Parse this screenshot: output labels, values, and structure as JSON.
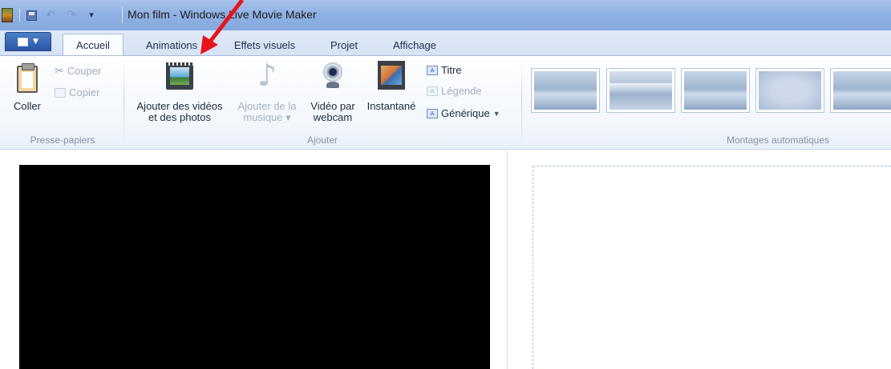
{
  "window": {
    "title": "Mon film - Windows Live Movie Maker"
  },
  "quick_access": {
    "app_icon": "movie-maker-icon",
    "save_icon": "save-icon",
    "undo_icon": "undo-icon",
    "redo_icon": "redo-icon",
    "dropdown_glyph": "▾"
  },
  "tabs": [
    {
      "label": "Accueil",
      "active": true
    },
    {
      "label": "Animations",
      "active": false
    },
    {
      "label": "Effets visuels",
      "active": false
    },
    {
      "label": "Projet",
      "active": false
    },
    {
      "label": "Affichage",
      "active": false
    }
  ],
  "ribbon": {
    "clipboard": {
      "paste_label": "Coller",
      "cut_label": "Couper",
      "copy_label": "Copier",
      "group_label": "Presse-papiers"
    },
    "add": {
      "add_videos_photos_label_1": "Ajouter des vidéos",
      "add_videos_photos_label_2": "et des photos",
      "add_music_label_1": "Ajouter de la",
      "add_music_label_2": "musique",
      "webcam_label_1": "Vidéo par",
      "webcam_label_2": "webcam",
      "snapshot_label": "Instantané",
      "title_label": "Titre",
      "caption_label": "Légende",
      "credits_label": "Générique",
      "group_label": "Ajouter"
    },
    "automovie": {
      "group_label": "Montages automatiques",
      "themes": [
        "theme-1",
        "theme-2",
        "theme-3",
        "theme-4",
        "theme-5"
      ]
    }
  },
  "annotation": {
    "arrow_color": "#e8141c"
  }
}
